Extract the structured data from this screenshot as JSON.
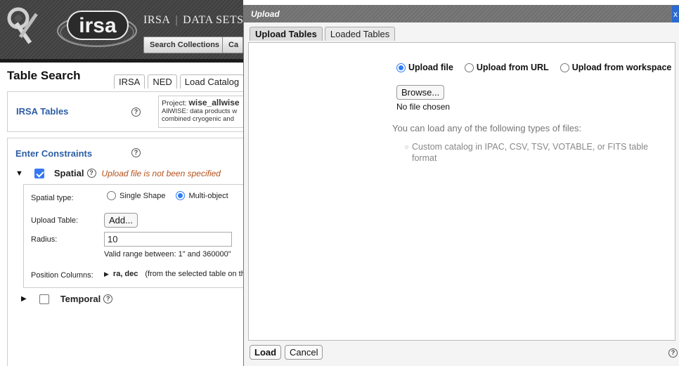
{
  "banner": {
    "title_left": "IRSA",
    "title_right": "DATA SETS",
    "buttons": [
      "Search Collections",
      "Ca"
    ]
  },
  "logo": {
    "text": "irsa"
  },
  "search": {
    "title": "Table Search",
    "tabs": [
      "IRSA",
      "NED",
      "Load Catalog"
    ]
  },
  "irsa_tables": {
    "label": "IRSA Tables",
    "help": "?",
    "project_prefix": "Project:",
    "project_name": "wise_allwise",
    "project_desc_1": "AllWISE: data products w",
    "project_desc_2": "combined cryogenic and"
  },
  "constraints": {
    "label": "Enter Constraints",
    "spatial_label": "Spatial",
    "spatial_warning": "Upload file is not been specified",
    "spatial_type_label": "Spatial type:",
    "spatial_type_options": [
      "Single Shape",
      "Multi-object"
    ],
    "spatial_type_selected": "Multi-object",
    "upload_table_label": "Upload Table:",
    "upload_table_button": "Add...",
    "radius_label": "Radius:",
    "radius_value": "10",
    "radius_hint": "Valid range between: 1\" and 360000\"",
    "position_columns_label": "Position Columns:",
    "position_columns_value": "ra, dec",
    "position_columns_note": "(from the selected table on th",
    "temporal_label": "Temporal"
  },
  "dialog": {
    "title": "Upload",
    "close": "x",
    "tabs": [
      "Upload Tables",
      "Loaded Tables"
    ],
    "active_tab": "Upload Tables",
    "source_options": [
      "Upload file",
      "Upload from URL",
      "Upload from workspace"
    ],
    "source_selected": "Upload file",
    "browse_label": "Browse...",
    "no_file": "No file chosen",
    "hint": "You can load any of the following types of files:",
    "hint_item": "Custom catalog in IPAC, CSV, TSV, VOTABLE, or FITS table format",
    "load_button": "Load",
    "cancel_button": "Cancel",
    "help": "?"
  },
  "colors": {
    "section_blue": "#2c5ea4",
    "warning_orange": "#b3521b",
    "radio_blue": "#2f7cf6",
    "checkbox_blue": "#3478f6"
  }
}
